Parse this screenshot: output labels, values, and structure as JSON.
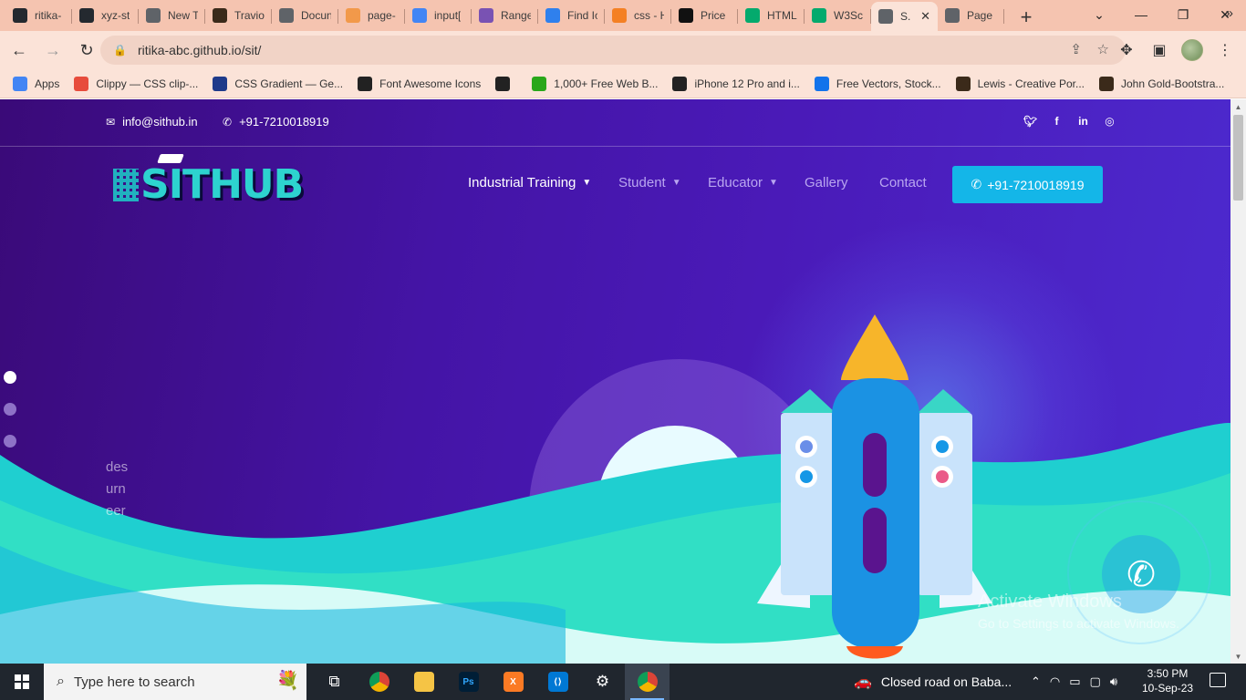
{
  "browser": {
    "tabs": [
      {
        "title": "ritika-",
        "icon": "github-icon",
        "color": "#24292f"
      },
      {
        "title": "xyz-st",
        "icon": "github-icon",
        "color": "#24292f"
      },
      {
        "title": "New T",
        "icon": "chrome-icon",
        "color": "#5f6368"
      },
      {
        "title": "Travio",
        "icon": "bookmark-image-icon",
        "color": "#3b2a1a"
      },
      {
        "title": "Docun",
        "icon": "globe-icon",
        "color": "#5f6368"
      },
      {
        "title": "page-",
        "icon": "t-logo-icon",
        "color": "#f2994a"
      },
      {
        "title": "input[",
        "icon": "google-icon",
        "color": "#4285f4"
      },
      {
        "title": "Range",
        "icon": "bootstrap-icon",
        "color": "#7952b3"
      },
      {
        "title": "Find Ic",
        "icon": "flag-icon",
        "color": "#2f80ed"
      },
      {
        "title": "css - H",
        "icon": "stackoverflow-icon",
        "color": "#f48024"
      },
      {
        "title": "Price",
        "icon": "codepen-icon",
        "color": "#111111"
      },
      {
        "title": "HTML",
        "icon": "w3schools-icon",
        "color": "#04aa6d"
      },
      {
        "title": "W3Sc",
        "icon": "w3schools-icon",
        "color": "#04aa6d"
      },
      {
        "title": "S.",
        "icon": "globe-icon",
        "color": "#5f6368",
        "active": true
      },
      {
        "title": "Page",
        "icon": "globe-icon",
        "color": "#5f6368"
      }
    ],
    "new_tab": "+",
    "url": "ritika-abc.github.io/sit/",
    "bookmarks": [
      {
        "label": "Apps",
        "icon": "apps-grid-icon",
        "color": "#4285f4"
      },
      {
        "label": "Clippy — CSS clip-...",
        "icon": "clippy-icon",
        "color": "#e74c3c"
      },
      {
        "label": "CSS Gradient — Ge...",
        "icon": "gradient-icon",
        "color": "#1e3a8a"
      },
      {
        "label": "Font Awesome Icons",
        "icon": "font-awesome-icon",
        "color": "#222222"
      },
      {
        "label": "",
        "icon": "globe-icon",
        "color": "#222222"
      },
      {
        "label": "1,000+ Free Web B...",
        "icon": "px-icon",
        "color": "#29a71a"
      },
      {
        "label": "iPhone 12 Pro and i...",
        "icon": "apple-icon",
        "color": "#222222"
      },
      {
        "label": "Free Vectors, Stock...",
        "icon": "freepik-icon",
        "color": "#1273eb"
      },
      {
        "label": "Lewis - Creative Por...",
        "icon": "portfolio-icon",
        "color": "#3b2a1a"
      },
      {
        "label": "John Gold-Bootstra...",
        "icon": "portfolio-icon",
        "color": "#3b2a1a"
      }
    ]
  },
  "site": {
    "email": "info@sithub.in",
    "phone": "+91-7210018919",
    "logo_text": "SITHUB",
    "nav": [
      {
        "label": "Industrial Training",
        "has_dropdown": true,
        "active": true
      },
      {
        "label": "Student",
        "has_dropdown": true
      },
      {
        "label": "Educator",
        "has_dropdown": true
      },
      {
        "label": "Gallery",
        "has_dropdown": false
      },
      {
        "label": "Contact",
        "has_dropdown": false
      }
    ],
    "cta_phone": "+91-7210018919",
    "hero_lines": [
      "des",
      "urn",
      "eer"
    ],
    "slider_dots": 3,
    "active_dot": 0,
    "colors": {
      "accent": "#14b6e8",
      "bg_dark": "#3a0a78",
      "wave": "#2ee6c2"
    }
  },
  "watermark": {
    "line1": "Activate Windows",
    "line2": "Go to Settings to activate Windows."
  },
  "taskbar": {
    "search_placeholder": "Type here to search",
    "news": "Closed road on Baba...",
    "time": "3:50 PM",
    "date": "10-Sep-23"
  }
}
